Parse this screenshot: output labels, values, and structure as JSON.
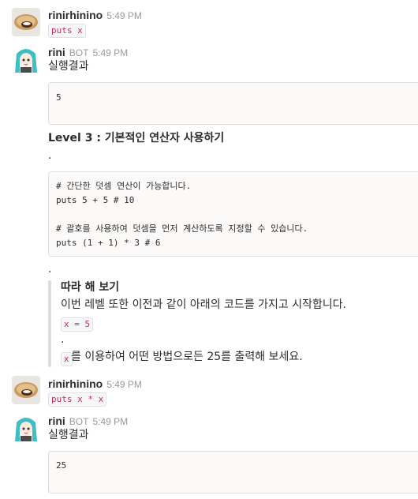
{
  "messages": [
    {
      "user": "rinirhinino",
      "time": "5:49 PM",
      "code": "puts x"
    },
    {
      "user": "rini",
      "bot_label": "BOT",
      "time": "5:49 PM",
      "result_title": "실행결과",
      "result_output": "5",
      "level_title": "Level 3 : 기본적인 연산자 사용하기",
      "dot1": ".",
      "code_block": [
        "# 간단한 덧셈 연산이 가능합니다.",
        "puts 5 + 5 # 10",
        "",
        "# 괄호를 사용하여 덧셈을 먼저 계산하도록 지정할 수 있습니다.",
        "puts (1 + 1) * 3 # 6"
      ],
      "dot2": ".",
      "quote": {
        "title": "따라 해 보기",
        "line1": "이번 레벨 또한 이전과 같이 아래의 코드를 가지고 시작합니다.",
        "code": "x = 5",
        "dot": ".",
        "code2": "x",
        "line2": "를 이용하여 어떤 방법으로든 25를 출력해 보세요."
      }
    },
    {
      "user": "rinirhinino",
      "time": "5:49 PM",
      "code": "puts x * x"
    },
    {
      "user": "rini",
      "bot_label": "BOT",
      "time": "5:49 PM",
      "result_title": "실행결과",
      "result_output": "25"
    }
  ]
}
